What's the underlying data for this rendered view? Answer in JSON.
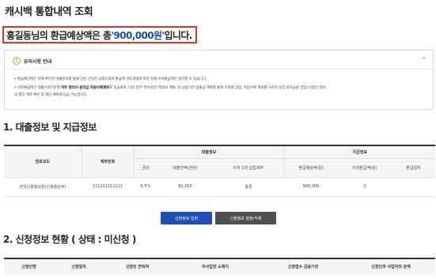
{
  "page": {
    "title": "캐시백 통합내역 조회"
  },
  "summary": {
    "prefix": "홍길동님의 환급예상액은 총 ",
    "amount": "'900,000원'",
    "suffix": " 입니다."
  },
  "notice": {
    "title": "유의사항 안내",
    "line1": "• 환급예상액은 현재 확인된 대출정보를 통해 단순 산정한 금액으로서 환급액 검토과정에 따라 실제 이자환급액은 달라질 수 있습니다.",
    "line2_pre": "• 이자환급액은 대출거래기관별 ",
    "line2_bold": "차주 명의의 원리금 자동이체계좌",
    "line2_post": "로 입금되며, 다만 일부 경우(타인 명의의 계좌, 타 금융기관 입출금 계좌를 통해 이자를 납입, 자동이체 계좌를 거치지 않고 원리금을 납입) 신청인 명의",
    "line3": "의 별도 계좌 확인 후 해당 계좌에 입금 가능합니다."
  },
  "section1": {
    "title": "1. 대출정보 및 지급정보"
  },
  "loan_table": {
    "col_branch": "점포코드",
    "col_account": "계좌번호",
    "group_loan": "대출정보",
    "group_pay": "지급정보",
    "sub": [
      "금리",
      "대출잔액(천원)",
      "이자 1년 납입여부",
      "환급예상액(원)",
      "이자환급액(원)",
      "환급일자"
    ],
    "row": {
      "branch": "한국신용정보원(신용정보부)",
      "account": "111111111111",
      "rate": "6.5%",
      "balance": "60,000",
      "paid": "충족",
      "expected": "900,000",
      "refund": "0",
      "date": ""
    }
  },
  "buttons": {
    "apply": "신청정보 입력",
    "edit": "신청정보 정정/삭제"
  },
  "section2": {
    "title": "2. 신청정보 현황 ( 상태 : 미신청 )"
  },
  "apply_table": {
    "headers": [
      "신청인명",
      "신청일자",
      "신청인 연락처",
      "주사업장 소재지",
      "신청접수 금융기관",
      "신청인과 사업자의 관계"
    ]
  }
}
